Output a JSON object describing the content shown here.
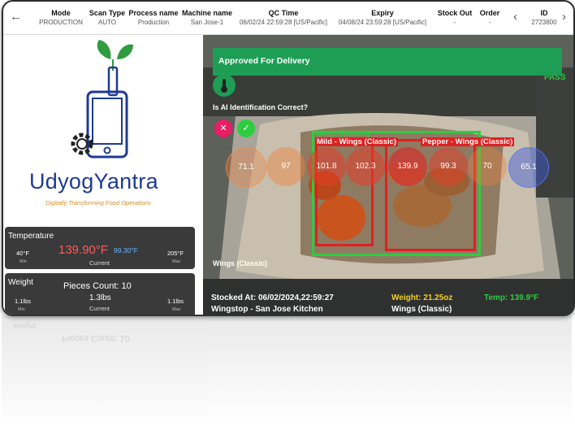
{
  "header": {
    "back_icon": "←",
    "prev_icon": "‹",
    "next_icon": "›",
    "mode": {
      "label": "Mode",
      "value": "PRODUCTION"
    },
    "scan_type": {
      "label": "Scan Type",
      "value": "AUTO"
    },
    "process_name": {
      "label": "Process name",
      "value": "Production"
    },
    "machine_name": {
      "label": "Machine name",
      "value": "San Jose-1"
    },
    "qc_time": {
      "label": "QC Time",
      "value": "06/02/24 22:59:28 [US/Pacific]"
    },
    "expiry": {
      "label": "Expiry",
      "value": "04/08/24 23:59:28 [US/Pacific]"
    },
    "stock_out": {
      "label": "Stock Out",
      "value": "-"
    },
    "order": {
      "label": "Order",
      "value": "-"
    },
    "id": {
      "label": "ID",
      "value": "2723800"
    }
  },
  "brand": {
    "name": "UdyogYantra",
    "tagline": "Digitally Transforming Food Operations",
    "colors": {
      "leaf": "#2e9c3f",
      "phone": "#1f3a93",
      "gear": "#222222",
      "tagline": "#d98b1f"
    }
  },
  "temperature": {
    "title": "Temperature",
    "min_value": "40°F",
    "min_label": "Min",
    "current_value": "139.90°F",
    "current_alt": "99.30°F",
    "current_label": "Current",
    "max_value": "205°F",
    "max_label": "Max"
  },
  "weight": {
    "title": "Weight",
    "pieces": "Pieces Count: 10",
    "min_value": "1.1lbs",
    "min_label": "Min",
    "current_value": "1.3lbs",
    "current_label": "Current",
    "max_value": "1.1lbs",
    "max_label": "Max"
  },
  "camera": {
    "banner": "Approved For Delivery",
    "question": "Is AI Identification Correct?",
    "reject_icon": "✕",
    "accept_icon": "✓",
    "thermometer_icon": "thermometer",
    "bubbles": [
      "71.1",
      "97",
      "101.8",
      "102.3",
      "139.9",
      "99.3",
      "70",
      "65.1"
    ],
    "label_top": "Wings (Classic)",
    "label_mild": "Mild - Wings (Classic)",
    "label_pepper": "Pepper - Wings (Classic)",
    "label_side": "Wings (Classic)",
    "stocked_at": "Stocked At: 06/02/2024,22:59:27",
    "location": "Wingstop - San Jose Kitchen",
    "weight_text": "Weight: 21.25oz",
    "bottom_item": "Wings (Classic)",
    "temp_text": "Temp: 139.9°F",
    "watermark": "fresco",
    "pass_text": "PASS",
    "colors": {
      "banner": "#1e9d55",
      "box_red": "#e02020",
      "box_green": "#2ecc40",
      "weight": "#f5d020",
      "temp": "#2ecc40"
    }
  }
}
